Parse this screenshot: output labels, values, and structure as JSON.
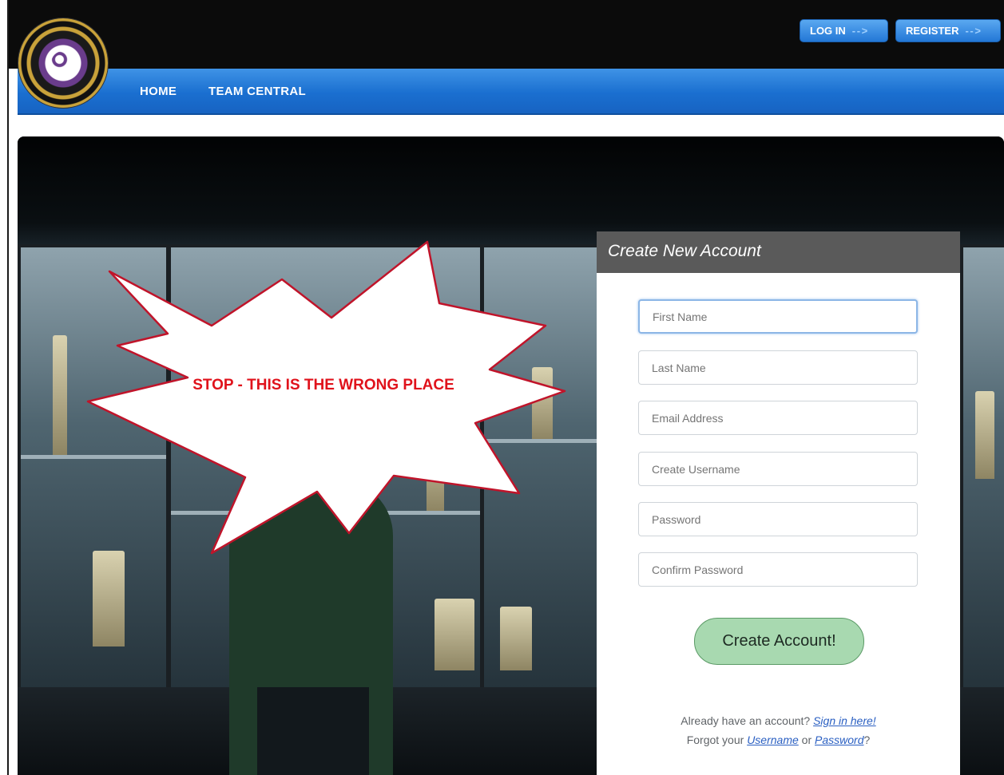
{
  "header": {
    "login_label": "LOG IN",
    "register_label": "REGISTER",
    "arrow_glyph": "- - >"
  },
  "nav": {
    "items": [
      {
        "label": "HOME"
      },
      {
        "label": "TEAM CENTRAL"
      }
    ]
  },
  "logo": {
    "icon": "association-seal-icon"
  },
  "banner": {
    "warning_text": "STOP - THIS IS THE WRONG PLACE"
  },
  "form": {
    "title": "Create New Account",
    "fields": [
      {
        "placeholder": "First Name"
      },
      {
        "placeholder": "Last Name"
      },
      {
        "placeholder": "Email Address"
      },
      {
        "placeholder": "Create Username"
      },
      {
        "placeholder": "Password"
      },
      {
        "placeholder": "Confirm Password"
      }
    ],
    "submit_label": "Create Account!",
    "signin_prompt": "Already have an account?",
    "signin_link": "Sign in here!",
    "forgot_prefix": "Forgot your",
    "forgot_username": "Username",
    "forgot_or": "or",
    "forgot_password": "Password",
    "forgot_suffix": "?"
  },
  "colors": {
    "nav_blue": "#1a6fd0",
    "warning_red": "#e0121b",
    "cta_green": "#a8d9b0",
    "panel_header": "#5a5a5a"
  }
}
